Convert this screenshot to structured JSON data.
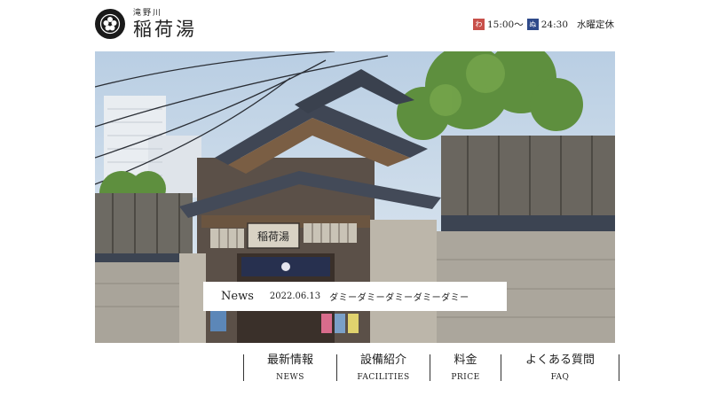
{
  "brand": {
    "sub": "滝野川",
    "name": "稲荷湯"
  },
  "hours": {
    "open_badge": "わ",
    "open_time": "15:00〜",
    "close_badge": "ぬ",
    "close_time": "24:30",
    "closed_day": "水曜定休",
    "colors": {
      "open": "#c8504a",
      "close": "#2f4a8a"
    }
  },
  "hero": {
    "sign_text": "稲荷湯"
  },
  "news": {
    "label": "News",
    "date": "2022.06.13",
    "title": "ダミーダミーダミーダミーダミー"
  },
  "nav": [
    {
      "jp": "最新情報",
      "en": "NEWS"
    },
    {
      "jp": "設備紹介",
      "en": "FACILITIES"
    },
    {
      "jp": "料金",
      "en": "PRICE"
    },
    {
      "jp": "よくある質問",
      "en": "FAQ"
    }
  ]
}
